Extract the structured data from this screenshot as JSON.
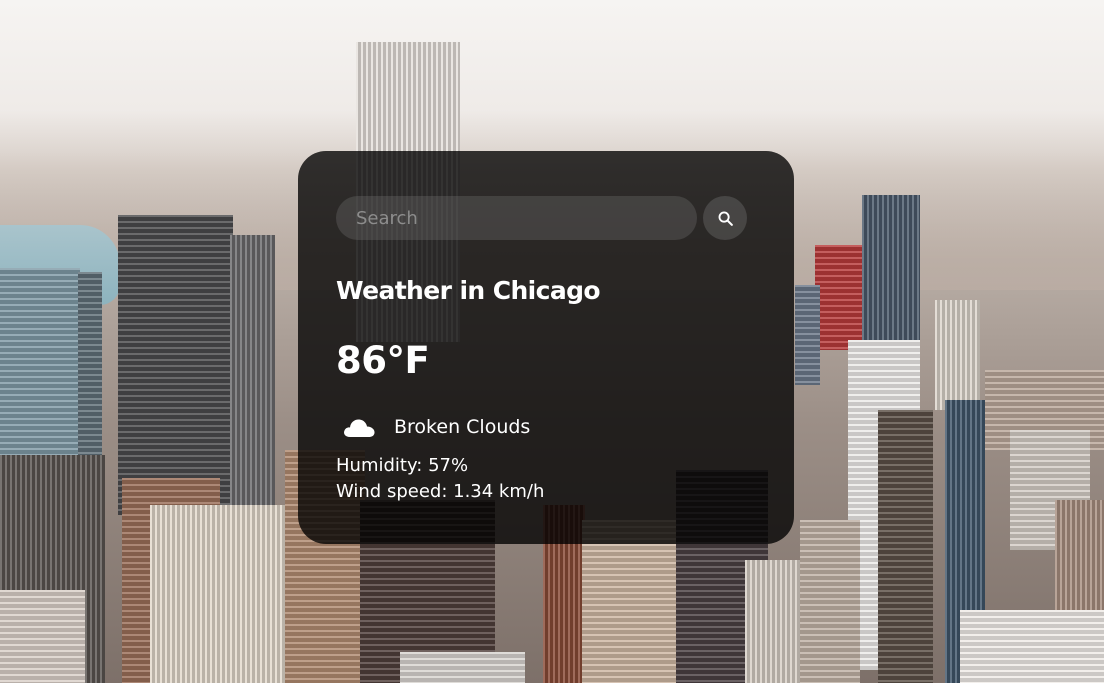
{
  "search": {
    "placeholder": "Search",
    "value": "",
    "button_icon": "search-icon"
  },
  "weather": {
    "title": "Weather in Chicago",
    "temperature": "86°F",
    "condition_icon": "cloud-icon",
    "condition": "Broken Clouds",
    "humidity": "Humidity: 57%",
    "wind": "Wind speed: 1.34 km/h"
  },
  "background": {
    "subject": "city-skyline-photo"
  }
}
